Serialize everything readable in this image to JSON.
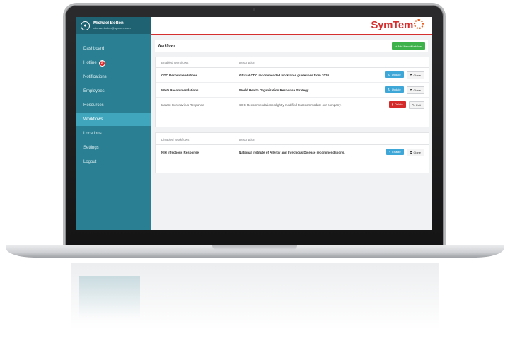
{
  "user": {
    "name": "Michael Bolton",
    "email": "michael.bolton@symtem.com"
  },
  "nav": {
    "items": [
      {
        "label": "Dashboard",
        "badge": ""
      },
      {
        "label": "Hotline",
        "badge": "2"
      },
      {
        "label": "Notifications",
        "badge": ""
      },
      {
        "label": "Employees",
        "badge": ""
      },
      {
        "label": "Resources",
        "badge": ""
      },
      {
        "label": "Workflows",
        "badge": "",
        "active": true
      },
      {
        "label": "Locations",
        "badge": ""
      },
      {
        "label": "Settings",
        "badge": ""
      },
      {
        "label": "Logout",
        "badge": ""
      }
    ]
  },
  "header": {
    "logo": "SymTem"
  },
  "page": {
    "title": "Workflows",
    "add_label": "+ Add New Workflow"
  },
  "enabled": {
    "col1": "Enabled Workflows",
    "col2": "Description",
    "rows": [
      {
        "name": "CDC Recommendations",
        "desc": "Official CDC recommended workforce guidelines from 2020.",
        "primary": "Update",
        "secondary": "Clone"
      },
      {
        "name": "WHO Recommendations",
        "desc": "World Health Organization Response Strategy.",
        "primary": "Update",
        "secondary": "Clone"
      },
      {
        "name": "Instant Coronavirus Response",
        "desc": "CDC Recommendations slightly modified to accommodate our company.",
        "primary": "Delete",
        "secondary": "Edit"
      }
    ]
  },
  "disabled": {
    "col1": "Disabled Workflows",
    "col2": "Description",
    "rows": [
      {
        "name": "NIH Infectious Response",
        "desc": "National Institute of Allergy and Infectious Disease recommendations.",
        "primary": "Enable",
        "secondary": "Clone"
      }
    ]
  },
  "colors": {
    "sidebar": "#2a7f92",
    "accent": "#d52f2f",
    "add": "#3db24a",
    "update": "#3fa6d8"
  }
}
